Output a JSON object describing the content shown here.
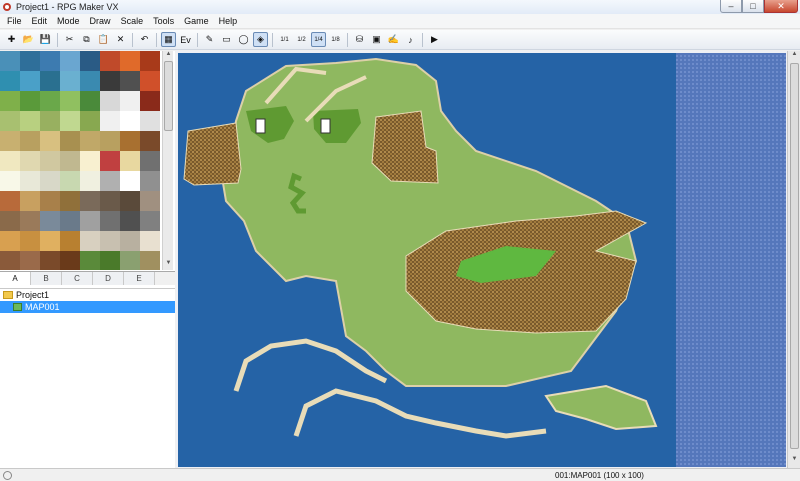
{
  "window": {
    "title": "Project1 - RPG Maker VX",
    "minimize": "–",
    "maximize": "□",
    "close": "✕"
  },
  "menu": [
    {
      "label": "File"
    },
    {
      "label": "Edit"
    },
    {
      "label": "Mode"
    },
    {
      "label": "Draw"
    },
    {
      "label": "Scale"
    },
    {
      "label": "Tools"
    },
    {
      "label": "Game"
    },
    {
      "label": "Help"
    }
  ],
  "toolbar": [
    {
      "icon": "new-project-icon",
      "glyph": "✚"
    },
    {
      "icon": "open-project-icon",
      "glyph": "📂"
    },
    {
      "icon": "save-icon",
      "glyph": "💾"
    },
    {
      "sep": true
    },
    {
      "icon": "cut-icon",
      "glyph": "✂"
    },
    {
      "icon": "copy-icon",
      "glyph": "⧉"
    },
    {
      "icon": "paste-icon",
      "glyph": "📋"
    },
    {
      "icon": "delete-icon",
      "glyph": "✕"
    },
    {
      "sep": true
    },
    {
      "icon": "undo-icon",
      "glyph": "↶"
    },
    {
      "sep": true
    },
    {
      "icon": "map-layer-icon",
      "glyph": "▦"
    },
    {
      "icon": "event-layer-icon",
      "glyph": "Ev"
    },
    {
      "sep": true
    },
    {
      "icon": "pencil-icon",
      "glyph": "✎"
    },
    {
      "icon": "rectangle-icon",
      "glyph": "▭"
    },
    {
      "icon": "ellipse-icon",
      "glyph": "◯"
    },
    {
      "icon": "fill-icon",
      "glyph": "◈"
    },
    {
      "sep": true
    },
    {
      "icon": "scale-1-1-icon",
      "glyph": "1/1"
    },
    {
      "icon": "scale-1-2-icon",
      "glyph": "1/2"
    },
    {
      "icon": "scale-1-4-icon",
      "glyph": "1/4"
    },
    {
      "icon": "scale-1-8-icon",
      "glyph": "1/8"
    },
    {
      "sep": true
    },
    {
      "icon": "database-icon",
      "glyph": "⛁"
    },
    {
      "icon": "materials-icon",
      "glyph": "▣"
    },
    {
      "icon": "script-editor-icon",
      "glyph": "✍"
    },
    {
      "icon": "sound-test-icon",
      "glyph": "♪"
    },
    {
      "sep": true
    },
    {
      "icon": "playtest-icon",
      "glyph": "▶"
    }
  ],
  "tileset_tabs": [
    {
      "label": "A"
    },
    {
      "label": "B"
    },
    {
      "label": "C"
    },
    {
      "label": "D"
    },
    {
      "label": "E"
    }
  ],
  "tree": {
    "project": "Project1",
    "map": "MAP001"
  },
  "status": {
    "text": "001:MAP001 (100 x 100)"
  },
  "colors": {
    "ocean": "#2563a6",
    "deep_ocean": "#5275b8",
    "grass": "#8fb860",
    "forest": "#5f9a32",
    "hill": "#8a6d3d",
    "shore": "#e9e0c6",
    "accent": "#3399ff"
  }
}
